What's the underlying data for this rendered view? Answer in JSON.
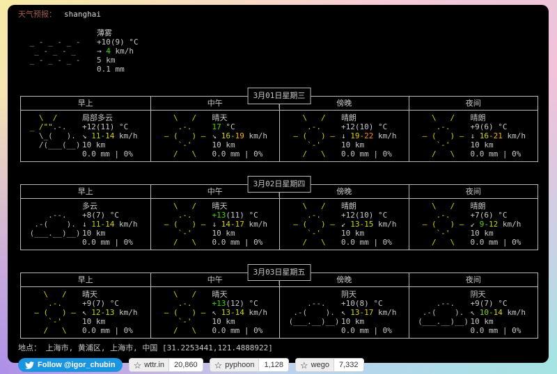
{
  "palette": {
    "fg": "#c9c9c9",
    "border": "#b9b9b9",
    "title_label": "#a25a50",
    "sun": "#d2d200",
    "cloud": "#bfbfbf",
    "mist": "#ababab",
    "green": "#3fd700",
    "twitter_blue": "#1b95e0"
  },
  "header": {
    "label": "天气预报：",
    "location": "shanghai"
  },
  "units": {
    "wind": "km/h"
  },
  "current": {
    "art_color": "mist",
    "art": [
      "",
      " _ - _ - _ -",
      "  _ - _ - _",
      " _ - _ - _ -",
      ""
    ],
    "cond": "薄雾",
    "temp": "+10(9) °C",
    "wind": {
      "arrow": "→",
      "value": "4",
      "unit": "km/h"
    },
    "visibility": "5 km",
    "precip": "0.1 mm"
  },
  "columns": [
    "早上",
    "中午",
    "傍晚",
    "夜间"
  ],
  "column_keys": [
    "morning",
    "noon",
    "evening",
    "night"
  ],
  "arts": {
    "partly_cloudy": [
      [
        [
          "   \\  /",
          "sun"
        ]
      ],
      [
        [
          " _ /\"\"",
          "sun"
        ],
        [
          ".-.",
          "cloud"
        ]
      ],
      [
        [
          "   \\_(   ).",
          "cloud"
        ]
      ],
      [
        [
          "   /(___(__)",
          "cloud"
        ]
      ],
      [
        [
          "",
          "cloud"
        ]
      ]
    ],
    "sunny": [
      [
        [
          "    \\   /",
          "sun"
        ]
      ],
      [
        [
          "     .-.",
          "sun"
        ]
      ],
      [
        [
          "  – (   ) –",
          "sun"
        ]
      ],
      [
        [
          "     `-'",
          "sun"
        ]
      ],
      [
        [
          "    /   \\",
          "sun"
        ]
      ]
    ],
    "cloudy": [
      [
        [
          "",
          "cloud"
        ]
      ],
      [
        [
          "     .--.",
          "cloud"
        ]
      ],
      [
        [
          "  .-(    ).",
          "cloud"
        ]
      ],
      [
        [
          " (___.__)__)",
          "cloud"
        ]
      ],
      [
        [
          "",
          "cloud"
        ]
      ]
    ]
  },
  "days": [
    {
      "date": "3月01日星期三",
      "cells": [
        {
          "art": "partly_cloudy",
          "cond": "局部多云",
          "temp": [
            [
              "+12(11) °C",
              "fg"
            ]
          ],
          "wind": {
            "arrow": "↘",
            "lo": "11",
            "lo_c": "#afd700",
            "hi": "14",
            "hi_c": "#d7d700"
          },
          "vis": "10 km",
          "precip": "0.0 mm | 0%"
        },
        {
          "art": "sunny",
          "cond": "晴天",
          "temp": [
            [
              "17",
              "green"
            ],
            [
              " °C",
              "fg"
            ]
          ],
          "wind": {
            "arrow": "↘",
            "lo": "16",
            "lo_c": "#d7d700",
            "hi": "19",
            "hi_c": "#ffaf00"
          },
          "vis": "10 km",
          "precip": "0.0 mm | 0%"
        },
        {
          "art": "sunny",
          "cond": "晴朗",
          "temp": [
            [
              "+12(10) °C",
              "fg"
            ]
          ],
          "wind": {
            "arrow": "↓",
            "lo": "19",
            "lo_c": "#dfd000",
            "hi": "22",
            "hi_c": "#ff8700"
          },
          "vis": "10 km",
          "precip": "0.0 mm | 0%"
        },
        {
          "art": "sunny",
          "cond": "晴朗",
          "temp": [
            [
              "+9(6) °C",
              "fg"
            ]
          ],
          "wind": {
            "arrow": "↓",
            "lo": "16",
            "lo_c": "#d7d700",
            "hi": "21",
            "hi_c": "#ffaf00"
          },
          "vis": "10 km",
          "precip": "0.0 mm | 0%"
        }
      ]
    },
    {
      "date": "3月02日星期四",
      "cells": [
        {
          "art": "cloudy",
          "cond": "多云",
          "temp": [
            [
              "+8(7) °C",
              "fg"
            ]
          ],
          "wind": {
            "arrow": "↓",
            "lo": "11",
            "lo_c": "#afd700",
            "hi": "14",
            "hi_c": "#d7d700"
          },
          "vis": "10 km",
          "precip": "0.0 mm | 0%"
        },
        {
          "art": "sunny",
          "cond": "晴天",
          "temp": [
            [
              "+13",
              "green"
            ],
            [
              "(11) °C",
              "fg"
            ]
          ],
          "wind": {
            "arrow": "↓",
            "lo": "14",
            "lo_c": "#d7d700",
            "hi": "17",
            "hi_c": "#e0c800"
          },
          "vis": "10 km",
          "precip": "0.0 mm | 0%"
        },
        {
          "art": "sunny",
          "cond": "晴朗",
          "temp": [
            [
              "+12(10) °C",
              "fg"
            ]
          ],
          "wind": {
            "arrow": "↙",
            "lo": "13",
            "lo_c": "#cdd700",
            "hi": "15",
            "hi_c": "#d7d700"
          },
          "vis": "10 km",
          "precip": "0.0 mm | 0%"
        },
        {
          "art": "sunny",
          "cond": "晴朗",
          "temp": [
            [
              "+7(6) °C",
              "fg"
            ]
          ],
          "wind": {
            "arrow": "↙",
            "lo": "9",
            "lo_c": "#52d700",
            "hi": "12",
            "hi_c": "#bcd700"
          },
          "vis": "10 km",
          "precip": "0.0 mm | 0%"
        }
      ]
    },
    {
      "date": "3月03日星期五",
      "cells": [
        {
          "art": "sunny",
          "cond": "晴天",
          "temp": [
            [
              "+9(7) °C",
              "fg"
            ]
          ],
          "wind": {
            "arrow": "↖",
            "lo": "12",
            "lo_c": "#bcd700",
            "hi": "13",
            "hi_c": "#cdd700"
          },
          "vis": "10 km",
          "precip": "0.0 mm | 0%"
        },
        {
          "art": "sunny",
          "cond": "晴天",
          "temp": [
            [
              "+13",
              "green"
            ],
            [
              "(12) °C",
              "fg"
            ]
          ],
          "wind": {
            "arrow": "↖",
            "lo": "13",
            "lo_c": "#cdd700",
            "hi": "14",
            "hi_c": "#d7d700"
          },
          "vis": "10 km",
          "precip": "0.0 mm | 0%"
        },
        {
          "art": "cloudy",
          "cond": "阴天",
          "temp": [
            [
              "+10(8) °C",
              "fg"
            ]
          ],
          "wind": {
            "arrow": "↖",
            "lo": "13",
            "lo_c": "#cdd700",
            "hi": "17",
            "hi_c": "#e0c800"
          },
          "vis": "10 km",
          "precip": "0.0 mm | 0%"
        },
        {
          "art": "cloudy",
          "cond": "阴天",
          "temp": [
            [
              "+9(7) °C",
              "fg"
            ]
          ],
          "wind": {
            "arrow": "↖",
            "lo": "10",
            "lo_c": "#87d700",
            "hi": "14",
            "hi_c": "#d7d700"
          },
          "vis": "10 km",
          "precip": "0.0 mm | 0%"
        }
      ]
    }
  ],
  "footer": {
    "label": "地点：",
    "location": "上海市, 黄浦区, 上海市, 中国 [31.2253441,121.4888922]",
    "badges": {
      "twitter": {
        "label": "Follow @igor_chubin"
      },
      "github": [
        {
          "name": "wttr.in",
          "count": "20,860"
        },
        {
          "name": "pyphoon",
          "count": "1,128"
        },
        {
          "name": "wego",
          "count": "7,332"
        }
      ]
    }
  }
}
